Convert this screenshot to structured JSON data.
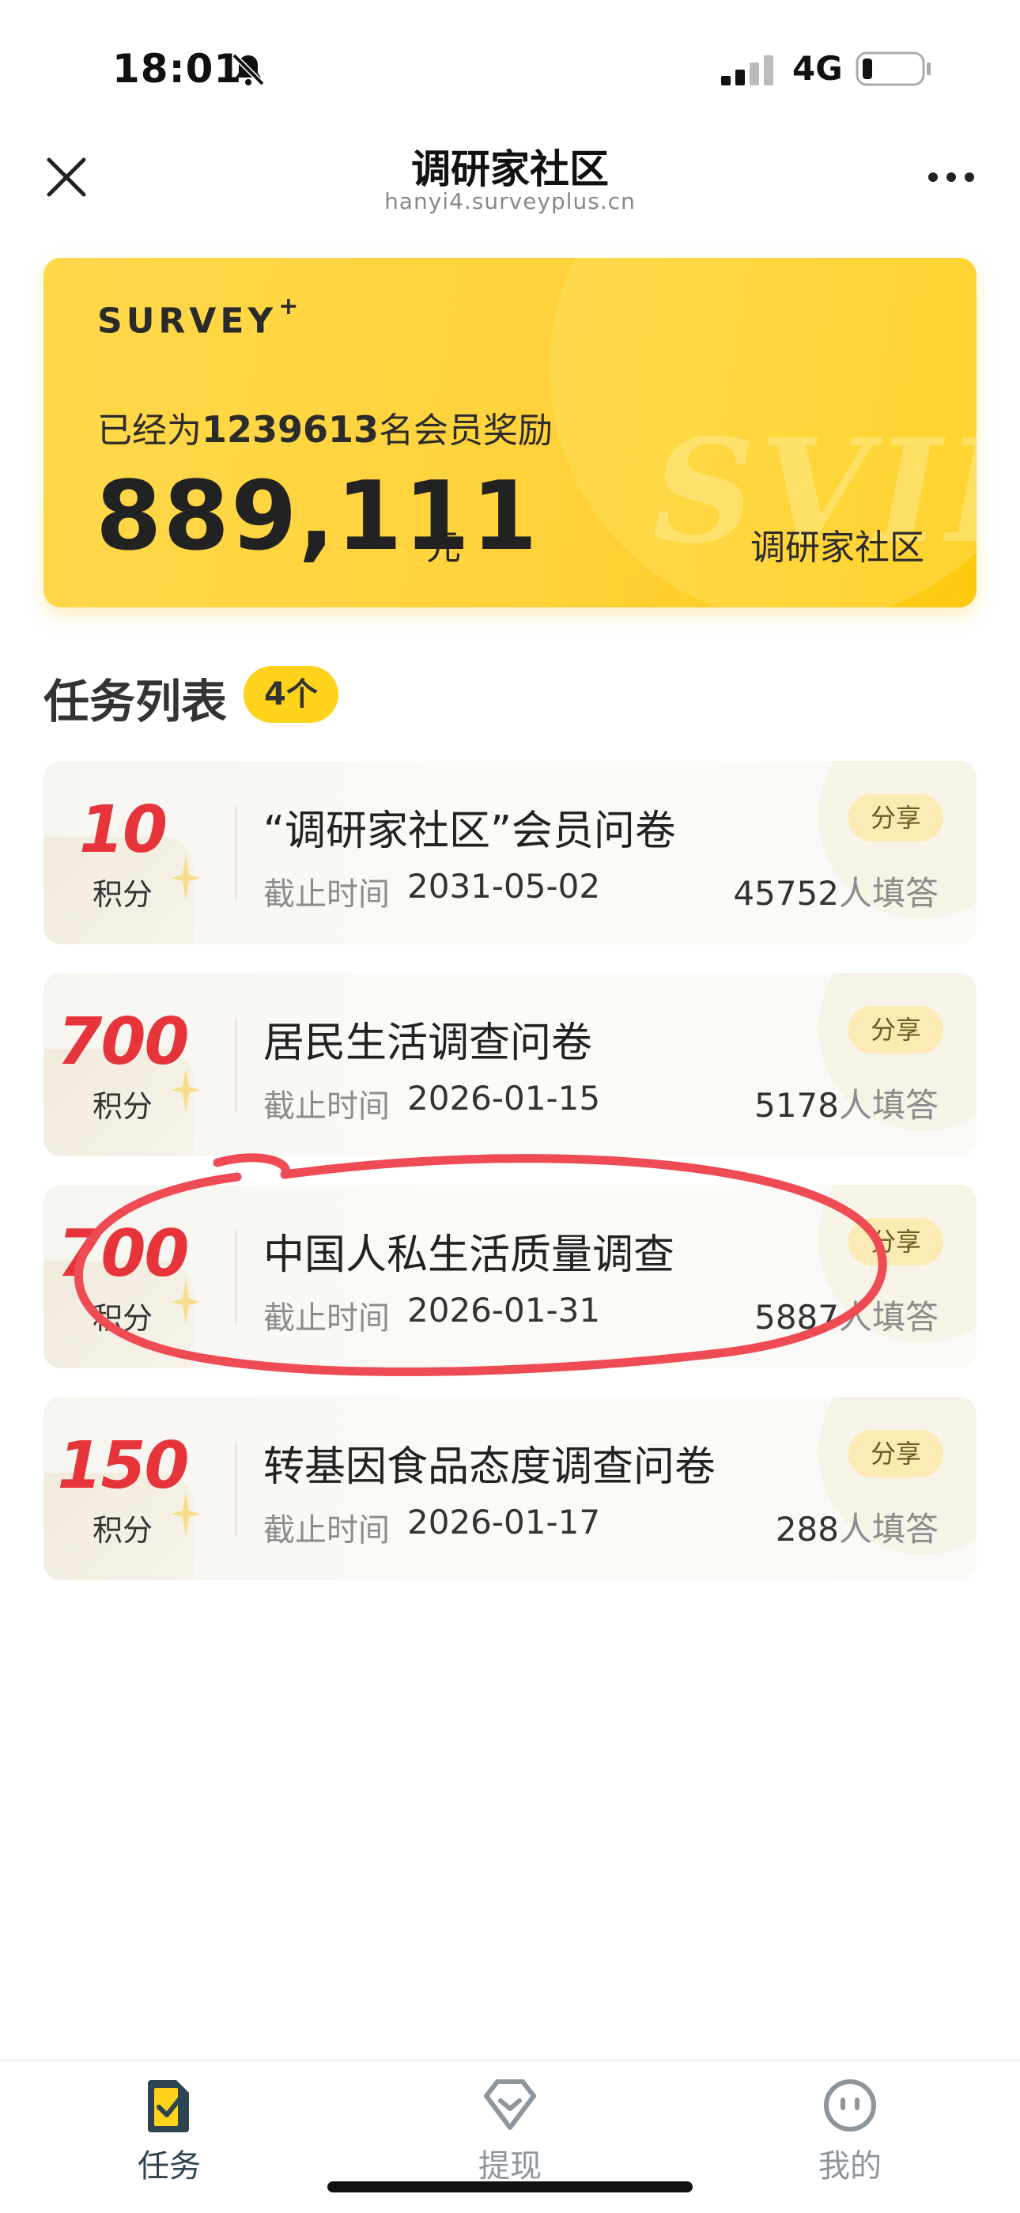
{
  "status_bar": {
    "time": "18:01",
    "network": "4G"
  },
  "nav": {
    "title": "调研家社区",
    "url": "hanyi4.surveyplus.cn"
  },
  "banner": {
    "logo": "SURVEY",
    "logo_sup": "+",
    "subtitle_prefix": "已经为",
    "member_count": "1239613",
    "subtitle_suffix": "名会员奖励",
    "amount": "889,111",
    "unit": "元",
    "brand": "调研家社区",
    "watermark": "SVIP"
  },
  "section": {
    "title": "任务列表",
    "count": "4个"
  },
  "tasks": [
    {
      "points": "10",
      "points_label": "积分",
      "title": "“调研家社区”会员问卷",
      "deadline_label": "截止时间",
      "deadline": "2031-05-02",
      "count": "45752",
      "count_suffix": "人填答",
      "share": "分享"
    },
    {
      "points": "700",
      "points_label": "积分",
      "title": "居民生活调查问卷",
      "deadline_label": "截止时间",
      "deadline": "2026-01-15",
      "count": "5178",
      "count_suffix": "人填答",
      "share": "分享"
    },
    {
      "points": "700",
      "points_label": "积分",
      "title": "中国人私生活质量调查",
      "deadline_label": "截止时间",
      "deadline": "2026-01-31",
      "count": "5887",
      "count_suffix": "人填答",
      "share": "分享"
    },
    {
      "points": "150",
      "points_label": "积分",
      "title": "转基因食品态度调查问卷",
      "deadline_label": "截止时间",
      "deadline": "2026-01-17",
      "count": "288",
      "count_suffix": "人填答",
      "share": "分享"
    }
  ],
  "tabs": [
    {
      "label": "任务",
      "icon": "task-icon",
      "active": true
    },
    {
      "label": "提现",
      "icon": "withdraw-icon",
      "active": false
    },
    {
      "label": "我的",
      "icon": "profile-icon",
      "active": false
    }
  ],
  "colors": {
    "accent": "#ffd21c",
    "points": "#e6343a",
    "annotation": "#ef4b55",
    "tab_active": "#2d4451",
    "tab_inactive": "#8d969c"
  }
}
